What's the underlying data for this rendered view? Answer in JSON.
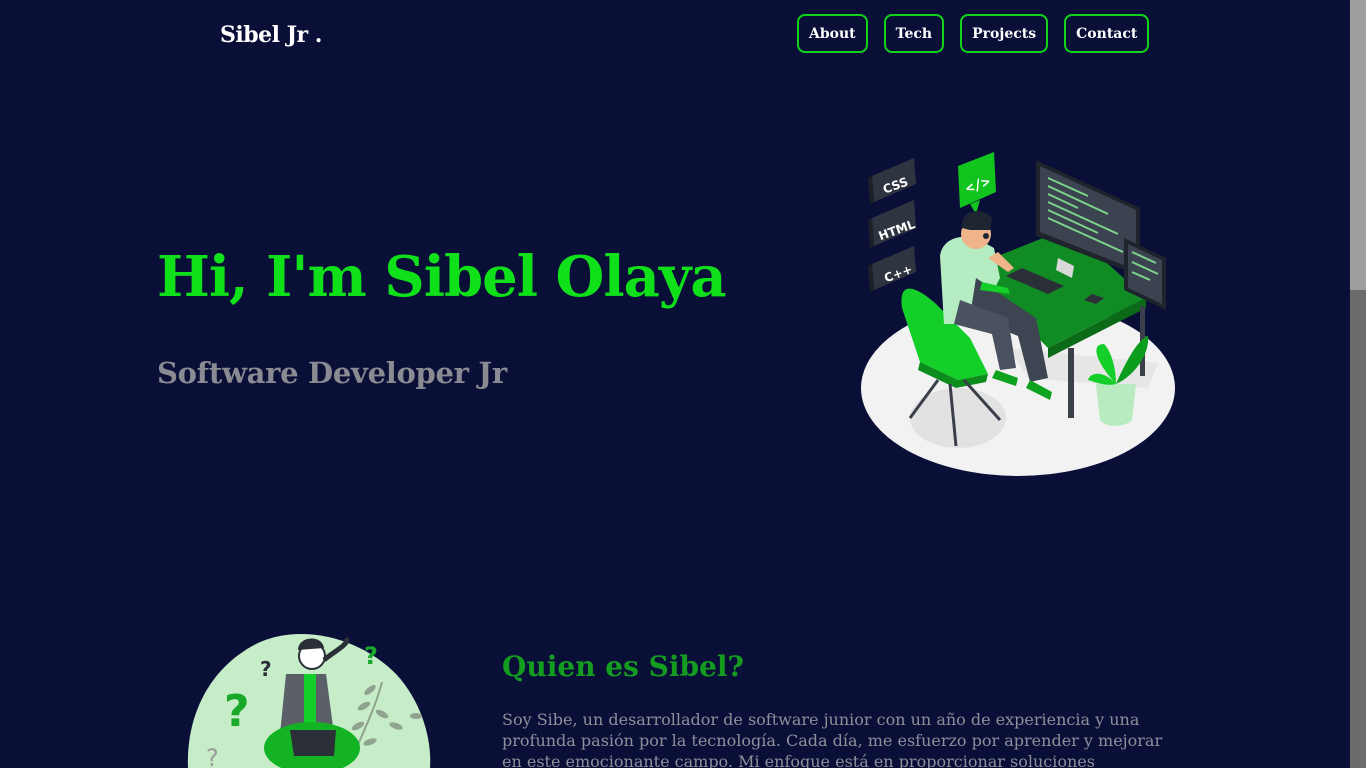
{
  "header": {
    "logo": "Sibel Jr .",
    "nav": [
      {
        "label": "About"
      },
      {
        "label": "Tech"
      },
      {
        "label": "Projects"
      },
      {
        "label": "Contact"
      }
    ]
  },
  "hero": {
    "title": "Hi, I'm Sibel Olaya",
    "subtitle": "Software Developer Jr",
    "illustration_badges": [
      "CSS",
      "HTML",
      "C++",
      "</>"
    ]
  },
  "about": {
    "title": "Quien es Sibel?",
    "text": "Soy Sibe, un desarrollador de software junior con un año de experiencia y una profunda pasión por la tecnología. Cada día, me esfuerzo por aprender y mejorar en este emocionante campo. Mi enfoque está en proporcionar soluciones tecnológicas eficientes y",
    "illustration_marks": [
      "?",
      "?",
      "?",
      "?"
    ]
  },
  "colors": {
    "background": "#0a0f38",
    "accent": "#10e01a",
    "accent_dark": "#139c1f",
    "muted_text": "#8a8a92",
    "white": "#ffffff"
  },
  "icons": {
    "hero": "developer-at-desk-illustration",
    "about": "thinking-person-illustration"
  }
}
